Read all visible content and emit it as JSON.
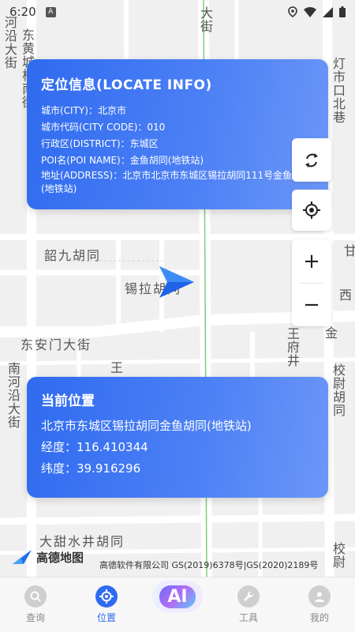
{
  "status_bar": {
    "time": "6:20",
    "app_badge": "A"
  },
  "map": {
    "labels": {
      "dajie": "大街",
      "dong_huang": "东黄城根南街",
      "he_yan": "河沿大街",
      "deng_shi": "灯市口北巷",
      "shao_jiu": "韶九胡同",
      "xi_la": "锡拉胡同",
      "dong_an_men": "东安门大街",
      "wang": "王",
      "wang_fu_jing": "王府井",
      "jin": "金",
      "xi": "西",
      "gan": "甘",
      "nan_he_yan": "南河沿大街",
      "xiao_wei": "校尉胡同",
      "da_tian_shui": "大甜水井胡同",
      "xiao_bottom": "校尉"
    }
  },
  "locate_info": {
    "title": "定位信息(LOCATE INFO)",
    "city": "城市(CITY)：北京市",
    "city_code": "城市代码(CITY CODE)：010",
    "district": "行政区(DISTRICT)：东城区",
    "poi_name": "POI名(POI NAME)：金鱼胡同(地铁站)",
    "address": "地址(ADDRESS)：北京市北京市东城区锡拉胡同111号金鱼胡同(地铁站)"
  },
  "current_position": {
    "title": "当前位置",
    "address": "北京市东城区锡拉胡同金鱼胡同(地铁站)",
    "longitude": "经度：116.410344",
    "latitude": "纬度：39.916296"
  },
  "map_controls": {
    "zoom_in": "+",
    "zoom_out": "−"
  },
  "logo": {
    "text": "高德地图"
  },
  "copyright": "高德软件有限公司 GS(2019)6378号|GS(2020)2189号",
  "tabs": [
    {
      "label": "查询"
    },
    {
      "label": "位置"
    },
    {
      "label": "AI"
    },
    {
      "label": "工具"
    },
    {
      "label": "我的"
    }
  ],
  "colors": {
    "accent": "#2f6bf0",
    "card_end": "#6c97f8",
    "map_bg": "#f2f2f2",
    "road": "#ffffff",
    "green_line": "#7ccf7c"
  }
}
